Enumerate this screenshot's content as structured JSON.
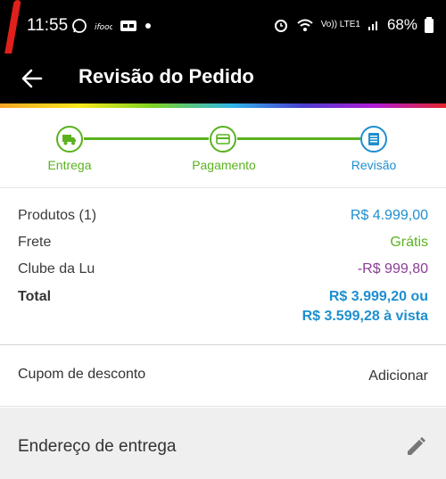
{
  "status": {
    "time": "11:55",
    "left_icons": [
      "whatsapp-icon",
      "app-icon",
      "caption-icon",
      "dot-icon"
    ],
    "lte": "Vo)) LTE1",
    "battery": "68%"
  },
  "header": {
    "title": "Revisão do Pedido"
  },
  "colors": {
    "green": "#5ab21f",
    "blue": "#1e8fcf",
    "purple": "#8a3e96"
  },
  "steps": [
    {
      "label": "Entrega",
      "icon": "truck-icon",
      "state": "done"
    },
    {
      "label": "Pagamento",
      "icon": "card-icon",
      "state": "done"
    },
    {
      "label": "Revisão",
      "icon": "document-icon",
      "state": "current"
    }
  ],
  "summary": {
    "products_label": "Produtos (1)",
    "products_value": "R$ 4.999,00",
    "shipping_label": "Frete",
    "shipping_value": "Grátis",
    "club_label": "Clube da Lu",
    "club_value": "-R$ 999,80",
    "total_label": "Total",
    "total_line1": "R$ 3.999,20 ou",
    "total_line2": "R$ 3.599,28 à vista"
  },
  "coupon": {
    "label": "Cupom de desconto",
    "action": "Adicionar"
  },
  "address": {
    "title": "Endereço de entrega",
    "icon": "edit-pencil-icon"
  }
}
